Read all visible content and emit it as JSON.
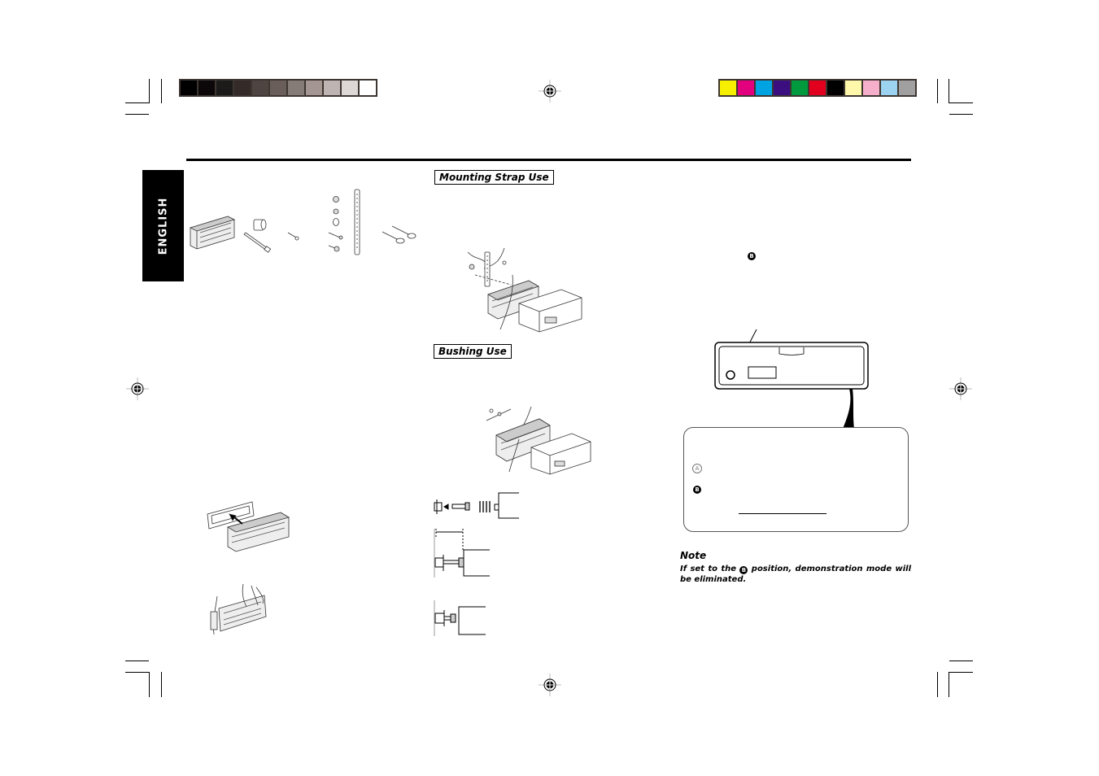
{
  "page": {
    "language_tab": "ENGLISH",
    "sections": {
      "mounting_strap": "Mounting Strap Use",
      "bushing": "Bushing Use"
    },
    "callout": {
      "label_a": "A",
      "label_b": "B",
      "pointer_label_b": "B"
    },
    "note": {
      "title": "Note",
      "text_before": "If set to the",
      "icon_letter": "B",
      "text_after": "position, demonstration mode will be eliminated."
    }
  },
  "color_bars": {
    "grayscale": [
      "#000000",
      "#0c0809",
      "#1d1b1a",
      "#342b28",
      "#4e4542",
      "#695e5a",
      "#857c78",
      "#a39693",
      "#beb4b1",
      "#ddd8d5",
      "#ffffff"
    ],
    "process": [
      "#f7ef00",
      "#e3007f",
      "#00a3e2",
      "#3b0f80",
      "#009a3e",
      "#e2001e",
      "#000000",
      "#fff8aa",
      "#f6afcb",
      "#9cd3f0",
      "#a0a0a0"
    ]
  }
}
